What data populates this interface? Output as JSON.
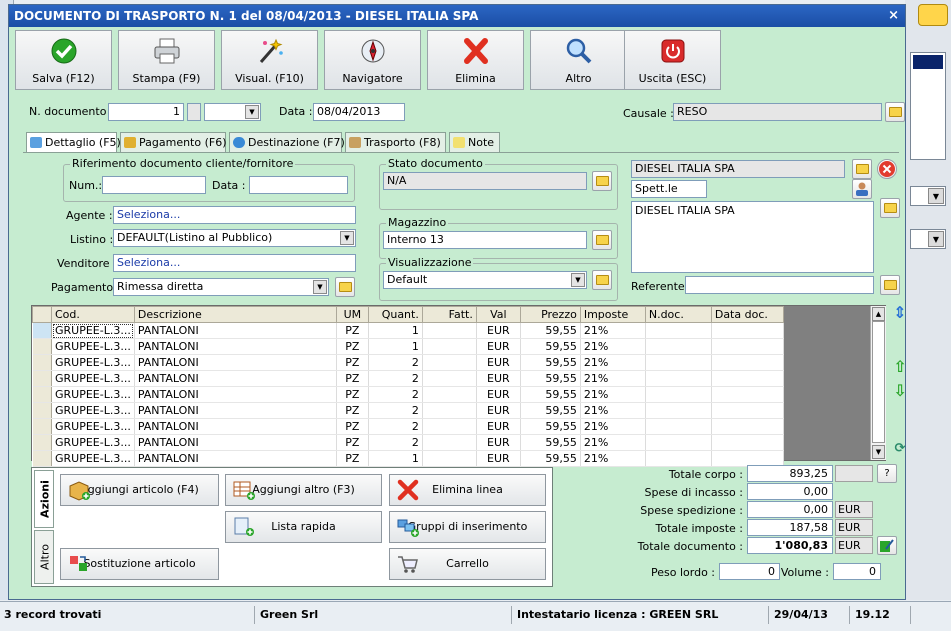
{
  "window": {
    "title": "DOCUMENTO DI TRASPORTO N. 1 del 08/04/2013 - DIESEL ITALIA SPA",
    "close": "×"
  },
  "toolbar": [
    {
      "label": "Salva (F12)",
      "icon": "check-icon"
    },
    {
      "label": "Stampa (F9)",
      "icon": "printer-icon"
    },
    {
      "label": "Visual. (F10)",
      "icon": "magic-wand-icon"
    },
    {
      "label": "Navigatore",
      "icon": "compass-icon"
    },
    {
      "label": "Elimina",
      "icon": "delete-x-icon"
    },
    {
      "label": "Altro",
      "icon": "magnifier-icon"
    },
    {
      "label": "Uscita (ESC)",
      "icon": "power-icon"
    }
  ],
  "header": {
    "n_documento_label": "N. documento :",
    "n_documento": "1",
    "data_label": "Data :",
    "data": "08/04/2013",
    "causale_label": "Causale :",
    "causale": "RESO"
  },
  "tabs": [
    "Dettaglio (F5)",
    "Pagamento (F6)",
    "Destinazione (F7)",
    "Trasporto (F8)",
    "Note"
  ],
  "riferimento": {
    "title": "Riferimento documento cliente/fornitore",
    "num_label": "Num.:",
    "num": "",
    "data_label": "Data :",
    "data": ""
  },
  "form": {
    "agente_label": "Agente :",
    "agente": "Seleziona...",
    "listino_label": "Listino :",
    "listino": "DEFAULT(Listino al Pubblico)",
    "venditore_label": "Venditore :",
    "venditore": "Seleziona...",
    "pagamento_label": "Pagamento :",
    "pagamento": "Rimessa diretta"
  },
  "stato": {
    "title": "Stato documento",
    "value": "N/A"
  },
  "magazzino": {
    "title": "Magazzino",
    "value": "Interno 13"
  },
  "visualizzazione": {
    "title": "Visualizzazione",
    "value": "Default"
  },
  "cliente": {
    "name": "DIESEL ITALIA SPA",
    "spett": "Spett.le",
    "address": "DIESEL ITALIA SPA",
    "referente_label": "Referente",
    "referente": ""
  },
  "grid": {
    "columns": [
      "Cod.",
      "Descrizione",
      "UM",
      "Quant.",
      "Fatt.",
      "Val",
      "Prezzo",
      "Imposte",
      "N.doc.",
      "Data doc."
    ],
    "rows": [
      [
        "GRUPEE-L.3...",
        "PANTALONI",
        "PZ",
        "1",
        "",
        "EUR",
        "59,55",
        "21%",
        "",
        ""
      ],
      [
        "GRUPEE-L.3...",
        "PANTALONI",
        "PZ",
        "1",
        "",
        "EUR",
        "59,55",
        "21%",
        "",
        ""
      ],
      [
        "GRUPEE-L.3...",
        "PANTALONI",
        "PZ",
        "2",
        "",
        "EUR",
        "59,55",
        "21%",
        "",
        ""
      ],
      [
        "GRUPEE-L.3...",
        "PANTALONI",
        "PZ",
        "2",
        "",
        "EUR",
        "59,55",
        "21%",
        "",
        ""
      ],
      [
        "GRUPEE-L.3...",
        "PANTALONI",
        "PZ",
        "2",
        "",
        "EUR",
        "59,55",
        "21%",
        "",
        ""
      ],
      [
        "GRUPEE-L.3...",
        "PANTALONI",
        "PZ",
        "2",
        "",
        "EUR",
        "59,55",
        "21%",
        "",
        ""
      ],
      [
        "GRUPEE-L.3...",
        "PANTALONI",
        "PZ",
        "2",
        "",
        "EUR",
        "59,55",
        "21%",
        "",
        ""
      ],
      [
        "GRUPEE-L.3...",
        "PANTALONI",
        "PZ",
        "2",
        "",
        "EUR",
        "59,55",
        "21%",
        "",
        ""
      ],
      [
        "GRUPEE-L.3...",
        "PANTALONI",
        "PZ",
        "1",
        "",
        "EUR",
        "59,55",
        "21%",
        "",
        ""
      ]
    ]
  },
  "actions": {
    "vtab_azioni": "Azioni",
    "vtab_altro": "Altro",
    "buttons": [
      "Aggiungi articolo (F4)",
      "Aggiungi altro (F3)",
      "Elimina linea",
      "Lista rapida",
      "Gruppi di inserimento",
      "Sostituzione articolo",
      "Carrello"
    ]
  },
  "totals": {
    "totale_corpo_label": "Totale corpo :",
    "totale_corpo": "893,25",
    "spese_incasso_label": "Spese di incasso :",
    "spese_incasso": "0,00",
    "spese_spedizione_label": "Spese spedizione :",
    "spese_spedizione": "0,00",
    "totale_imposte_label": "Totale imposte :",
    "totale_imposte": "187,58",
    "totale_documento_label": "Totale documento :",
    "totale_documento": "1'080,83",
    "currency": "EUR",
    "help": "?",
    "peso_lordo_label": "Peso lordo :",
    "peso_lordo": "0",
    "volume_label": "Volume :",
    "volume": "0"
  },
  "status": {
    "records": "3 record trovati",
    "company": "Green Srl",
    "license": "Intestatario licenza : GREEN SRL",
    "date": "29/04/13",
    "time": "19.12"
  },
  "colors": {
    "panel": "#c6ecd0",
    "title": "#1b4ea5"
  }
}
